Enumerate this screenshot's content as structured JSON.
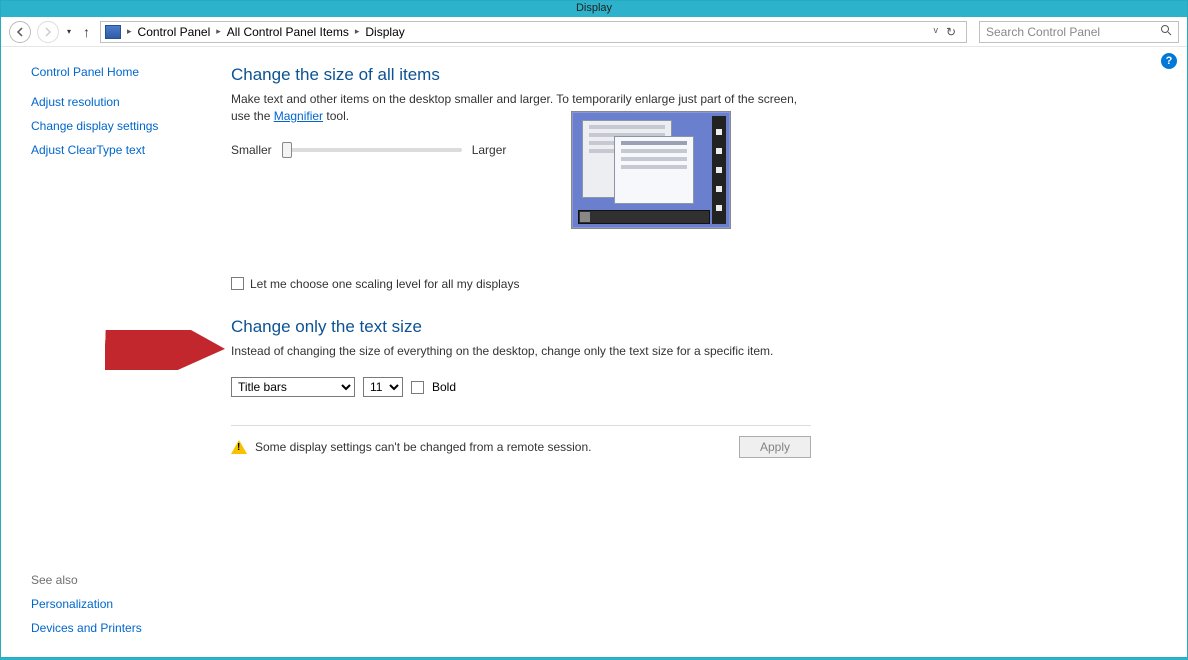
{
  "titlebar": "Display",
  "breadcrumbs": [
    "Control Panel",
    "All Control Panel Items",
    "Display"
  ],
  "search_placeholder": "Search Control Panel",
  "sidebar": {
    "home": "Control Panel Home",
    "links": [
      "Adjust resolution",
      "Change display settings",
      "Adjust ClearType text"
    ],
    "seealso_header": "See also",
    "seealso": [
      "Personalization",
      "Devices and Printers"
    ]
  },
  "section1": {
    "heading": "Change the size of all items",
    "desc_pre": "Make text and other items on the desktop smaller and larger. To temporarily enlarge just part of the screen, use the ",
    "magnifier": "Magnifier",
    "desc_post": " tool.",
    "smaller": "Smaller",
    "larger": "Larger",
    "checkbox_label": "Let me choose one scaling level for all my displays"
  },
  "section2": {
    "heading": "Change only the text size",
    "desc": "Instead of changing the size of everything on the desktop, change only the text size for a specific item.",
    "item_select": "Title bars",
    "size_select": "11",
    "bold_label": "Bold"
  },
  "footer": {
    "warning": "Some display settings can't be changed from a remote session.",
    "apply": "Apply"
  }
}
